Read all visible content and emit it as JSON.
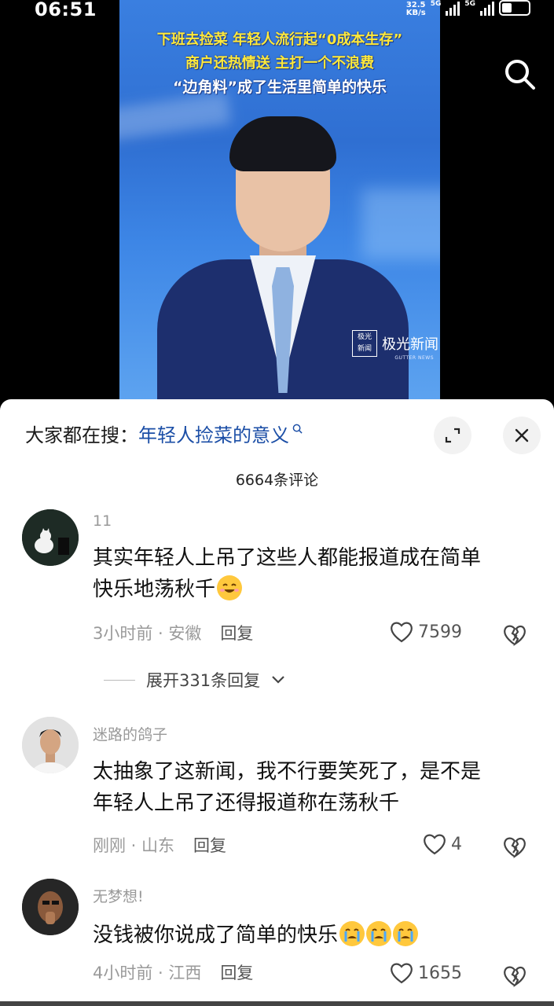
{
  "status": {
    "time": "06:51",
    "net_speed": "32.5",
    "net_unit": "KB/s",
    "signal_1": "5G",
    "signal_2": "5G"
  },
  "video": {
    "headline_line1": "下班去捡菜 年轻人流行起“0成本生存”",
    "headline_line2": "商户还热情送 主打一个不浪费",
    "headline_line3": "“边角料”成了生活里简单的快乐",
    "brand_box": "极光\n新闻",
    "brand_name": "极光新闻",
    "brand_sub": "GUTTER NEWS"
  },
  "sheet": {
    "search_label": "大家都在搜：",
    "search_term": "年轻人捡菜的意义",
    "comment_count": "6664条评论"
  },
  "comments": [
    {
      "username": "11",
      "text_line1": "其实年轻人上吊了这些人都能报道成在简单",
      "text_line2": "快乐地荡秋千",
      "time": "3小时前",
      "location": "安徽",
      "reply": "回复",
      "likes": "7599",
      "expand": "展开331条回复"
    },
    {
      "username": "迷路的鸽子",
      "text_line1": "太抽象了这新闻，我不行要笑死了，是不是",
      "text_line2": "年轻人上吊了还得报道称在荡秋千",
      "time": "刚刚",
      "location": "山东",
      "reply": "回复",
      "likes": "4"
    },
    {
      "username": "无梦想!",
      "text_line1": "没钱被你说成了简单的快乐",
      "time": "4小时前",
      "location": "江西",
      "reply": "回复",
      "likes": "1655"
    }
  ],
  "icons": {
    "search": "search-icon",
    "expand": "expand-icon",
    "close": "close-icon",
    "heart": "heart-icon",
    "broken_heart": "broken-heart-icon",
    "chevron": "chevron-down-icon"
  },
  "colors": {
    "search_term": "#1b4ea6",
    "video_bg": "#3a7fe0",
    "headline": "#ffe93a"
  }
}
